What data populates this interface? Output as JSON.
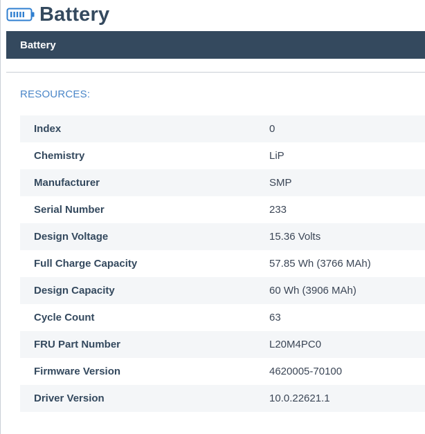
{
  "page": {
    "title": "Battery",
    "icon": "battery-icon"
  },
  "section": {
    "header": "Battery"
  },
  "resources": {
    "label": "RESOURCES:",
    "rows": [
      {
        "key": "Index",
        "value": "0"
      },
      {
        "key": "Chemistry",
        "value": "LiP"
      },
      {
        "key": "Manufacturer",
        "value": "SMP"
      },
      {
        "key": "Serial Number",
        "value": "233"
      },
      {
        "key": "Design Voltage",
        "value": "15.36 Volts"
      },
      {
        "key": "Full Charge Capacity",
        "value": "57.85 Wh (3766 MAh)"
      },
      {
        "key": "Design Capacity",
        "value": "60 Wh (3906 MAh)"
      },
      {
        "key": "Cycle Count",
        "value": "63"
      },
      {
        "key": "FRU Part Number",
        "value": "L20M4PC0"
      },
      {
        "key": "Firmware Version",
        "value": "4620005-70100"
      },
      {
        "key": "Driver Version",
        "value": "10.0.22621.1"
      }
    ]
  },
  "colors": {
    "header_bg": "#34495e",
    "accent": "#4a86c8",
    "row_alt": "#f4f6f8"
  }
}
